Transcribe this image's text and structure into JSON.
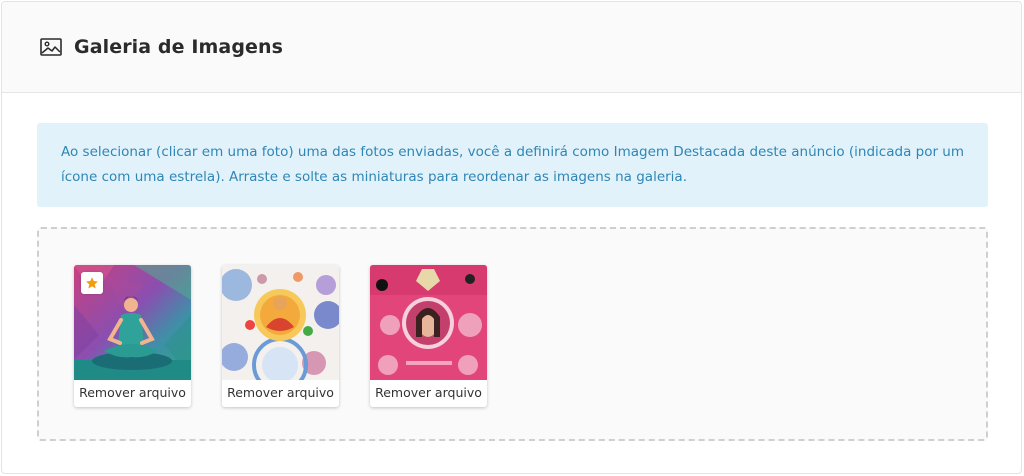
{
  "header": {
    "title": "Galeria de Imagens",
    "icon": "image-icon"
  },
  "notice": {
    "text": "Ao selecionar (clicar em uma foto) uma das fotos enviadas, você a definirá como Imagem Destacada deste anúncio (indicada por um ícone com uma estrela). Arraste e solte as miniaturas para reordenar as imagens na galeria."
  },
  "gallery": {
    "items": [
      {
        "remove_label": "Remover arquivo",
        "featured": true,
        "image": "meditation-woman-illustration"
      },
      {
        "remove_label": "Remover arquivo",
        "featured": false,
        "image": "buddha-mandala-collage"
      },
      {
        "remove_label": "Remover arquivo",
        "featured": false,
        "image": "pink-portrait-collage"
      }
    ],
    "featured_icon": "star-icon",
    "featured_color": "#f39c12"
  },
  "colors": {
    "notice_bg": "#e1f2fb",
    "notice_text": "#2f86b5"
  }
}
